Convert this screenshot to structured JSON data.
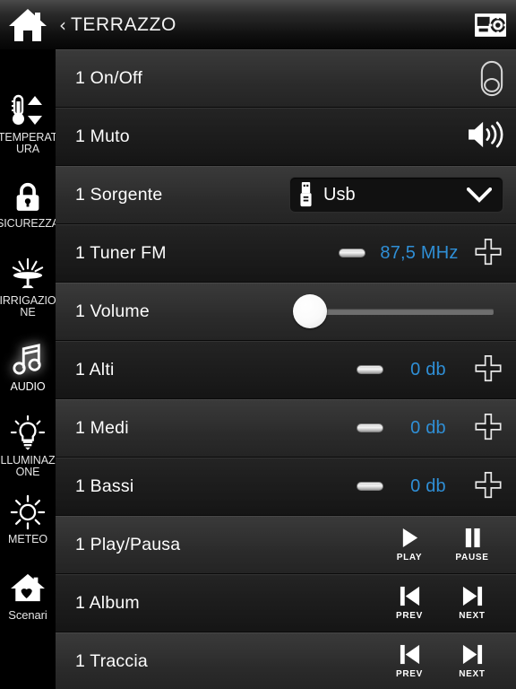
{
  "header": {
    "home_icon": "home-icon",
    "back_chevron": "‹",
    "title": "TERRAZZO",
    "right_icon": "control-panel-icon"
  },
  "sidebar": {
    "items": [
      {
        "id": "temperatura",
        "label": "TEMPERAT\nURA",
        "icon": "thermometer-icon",
        "active": false
      },
      {
        "id": "sicurezza",
        "label": "SICUREZZA",
        "icon": "lock-icon",
        "active": false
      },
      {
        "id": "irrigazione",
        "label": "IRRIGAZIO\nNE",
        "icon": "sprinkler-icon",
        "active": false
      },
      {
        "id": "audio",
        "label": "AUDIO",
        "icon": "music-note-icon",
        "active": true
      },
      {
        "id": "illuminazione",
        "label": "ILLUMINAZI\nONE",
        "icon": "lightbulb-icon",
        "active": false
      },
      {
        "id": "meteo",
        "label": "METEO",
        "icon": "sun-icon",
        "active": false
      },
      {
        "id": "scenari",
        "label": "Scenari",
        "icon": "home-heart-icon",
        "active": false
      }
    ]
  },
  "colors": {
    "accent_blue": "#2f8fd6",
    "row_light": "#303030",
    "row_dark": "#1d1d1d",
    "text": "#fdfdfd"
  },
  "list": {
    "rows": [
      {
        "id": "onoff",
        "label": "1 On/Off",
        "type": "toggle",
        "state": "off",
        "icon": "toggle-off-icon"
      },
      {
        "id": "muto",
        "label": "1 Muto",
        "type": "icon",
        "icon": "speaker-volume-icon"
      },
      {
        "id": "sorgente",
        "label": "1 Sorgente",
        "type": "dropdown",
        "value": "Usb",
        "value_icon": "usb-icon",
        "chevron": "chevron-down-icon"
      },
      {
        "id": "tuner",
        "label": "1 Tuner FM",
        "type": "stepper",
        "value": "87,5 MHz",
        "minus": "minus-icon",
        "plus": "plus-icon"
      },
      {
        "id": "volume",
        "label": "1 Volume",
        "type": "slider",
        "value": 0,
        "min": 0,
        "max": 100
      },
      {
        "id": "alti",
        "label": "1 Alti",
        "type": "stepper",
        "value": "0 db",
        "minus": "minus-icon",
        "plus": "plus-icon"
      },
      {
        "id": "medi",
        "label": "1 Medi",
        "type": "stepper",
        "value": "0 db",
        "minus": "minus-icon",
        "plus": "plus-icon"
      },
      {
        "id": "bassi",
        "label": "1 Bassi",
        "type": "stepper",
        "value": "0 db",
        "minus": "minus-icon",
        "plus": "plus-icon"
      },
      {
        "id": "playpausa",
        "label": "1 Play/Pausa",
        "type": "transport",
        "btn1_label": "PLAY",
        "btn1_icon": "play-icon",
        "btn2_label": "PAUSE",
        "btn2_icon": "pause-icon"
      },
      {
        "id": "album",
        "label": "1 Album",
        "type": "transport",
        "btn1_label": "PREV",
        "btn1_icon": "skip-previous-icon",
        "btn2_label": "NEXT",
        "btn2_icon": "skip-next-icon"
      },
      {
        "id": "traccia",
        "label": "1 Traccia",
        "type": "transport",
        "btn1_label": "PREV",
        "btn1_icon": "skip-previous-icon",
        "btn2_label": "NEXT",
        "btn2_icon": "skip-next-icon"
      }
    ]
  }
}
